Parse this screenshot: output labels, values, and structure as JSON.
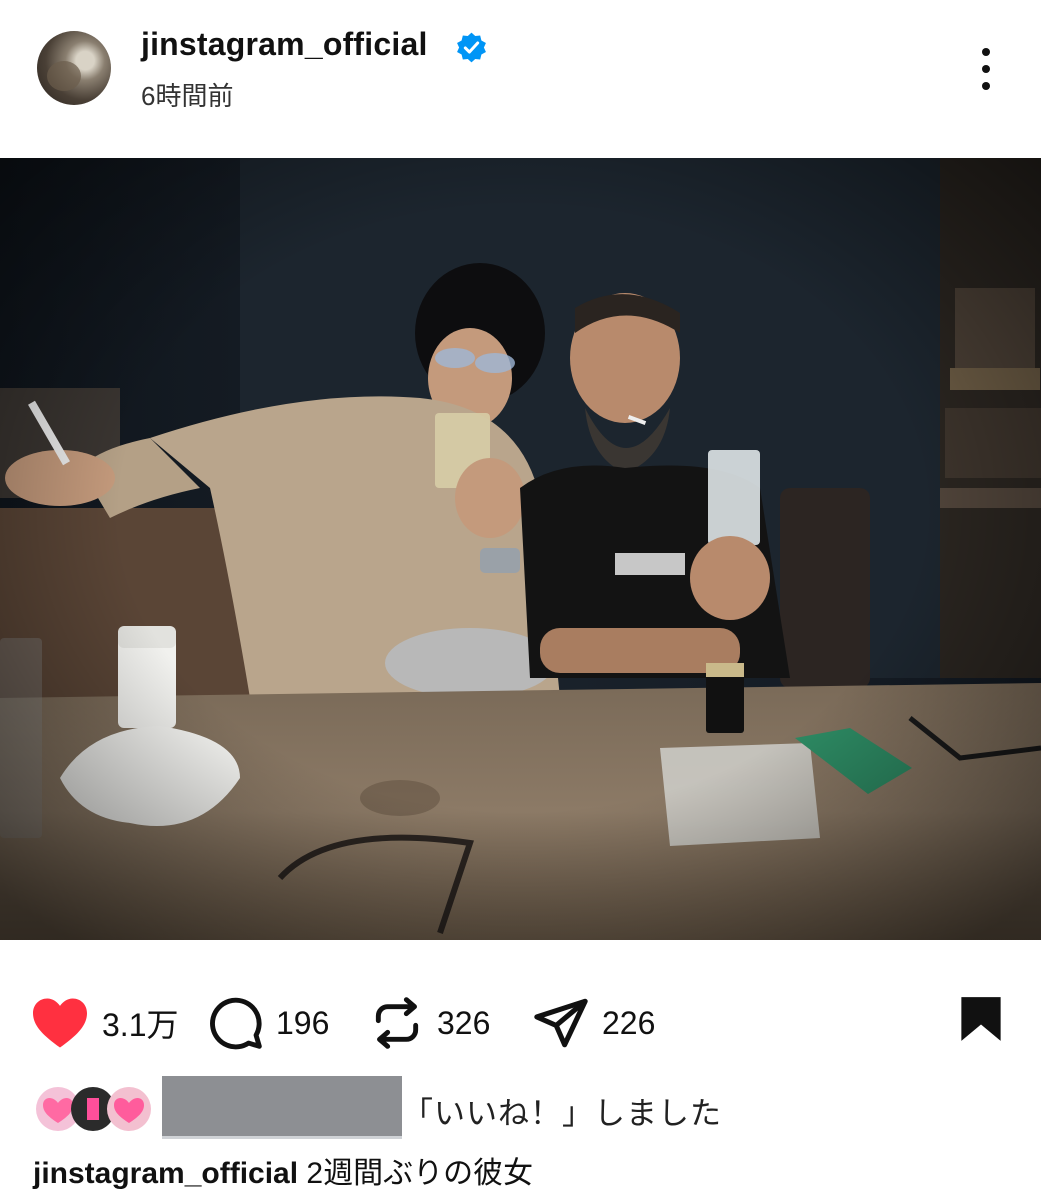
{
  "post": {
    "username": "jinstagram_official",
    "timestamp": "6時間前",
    "photo_description": "Photo of two men seated at a wooden table in a dark bar"
  },
  "actions": {
    "likes": "3.1万",
    "comments": "196",
    "reposts": "326",
    "shares": "226"
  },
  "liked_by": {
    "text": "「いいね！」しました"
  },
  "caption": {
    "username": "jinstagram_official",
    "text": "2週間ぶりの彼女"
  },
  "colors": {
    "like_red": "#ff3040",
    "verified_blue": "#0095f6"
  },
  "icons": [
    "verified-badge-icon",
    "more-options-icon",
    "heart-icon",
    "comment-icon",
    "repost-icon",
    "share-icon",
    "bookmark-icon"
  ]
}
